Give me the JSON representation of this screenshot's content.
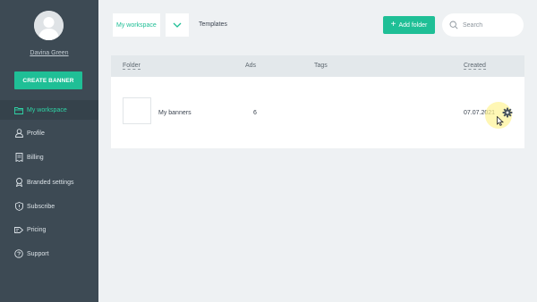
{
  "user": {
    "name": "Davina Green"
  },
  "sidebar": {
    "create_button": "CREATE BANNER",
    "items": [
      {
        "label": "My workspace",
        "icon": "folder-icon",
        "active": true
      },
      {
        "label": "Profile",
        "icon": "user-icon"
      },
      {
        "label": "Billing",
        "icon": "receipt-icon"
      },
      {
        "label": "Branded settings",
        "icon": "badge-icon"
      },
      {
        "label": "Subscribe",
        "icon": "shield-icon"
      },
      {
        "label": "Pricing",
        "icon": "price-tag-icon"
      },
      {
        "label": "Support",
        "icon": "help-icon"
      }
    ]
  },
  "toolbar": {
    "workspace_value": "My workspace",
    "templates_tab": "Templates",
    "add_folder_label": "Add folder",
    "search_placeholder": "Search"
  },
  "table": {
    "columns": [
      "Folder",
      "Ads",
      "Tags",
      "Created"
    ],
    "rows": [
      {
        "folder": "My banners",
        "ads": "6",
        "tags": "",
        "created": "07.07.2021"
      }
    ]
  },
  "colors": {
    "accent": "#1fbf96",
    "sidebar_bg": "#3d4a54",
    "active_nav_text": "#2fd3a5"
  }
}
